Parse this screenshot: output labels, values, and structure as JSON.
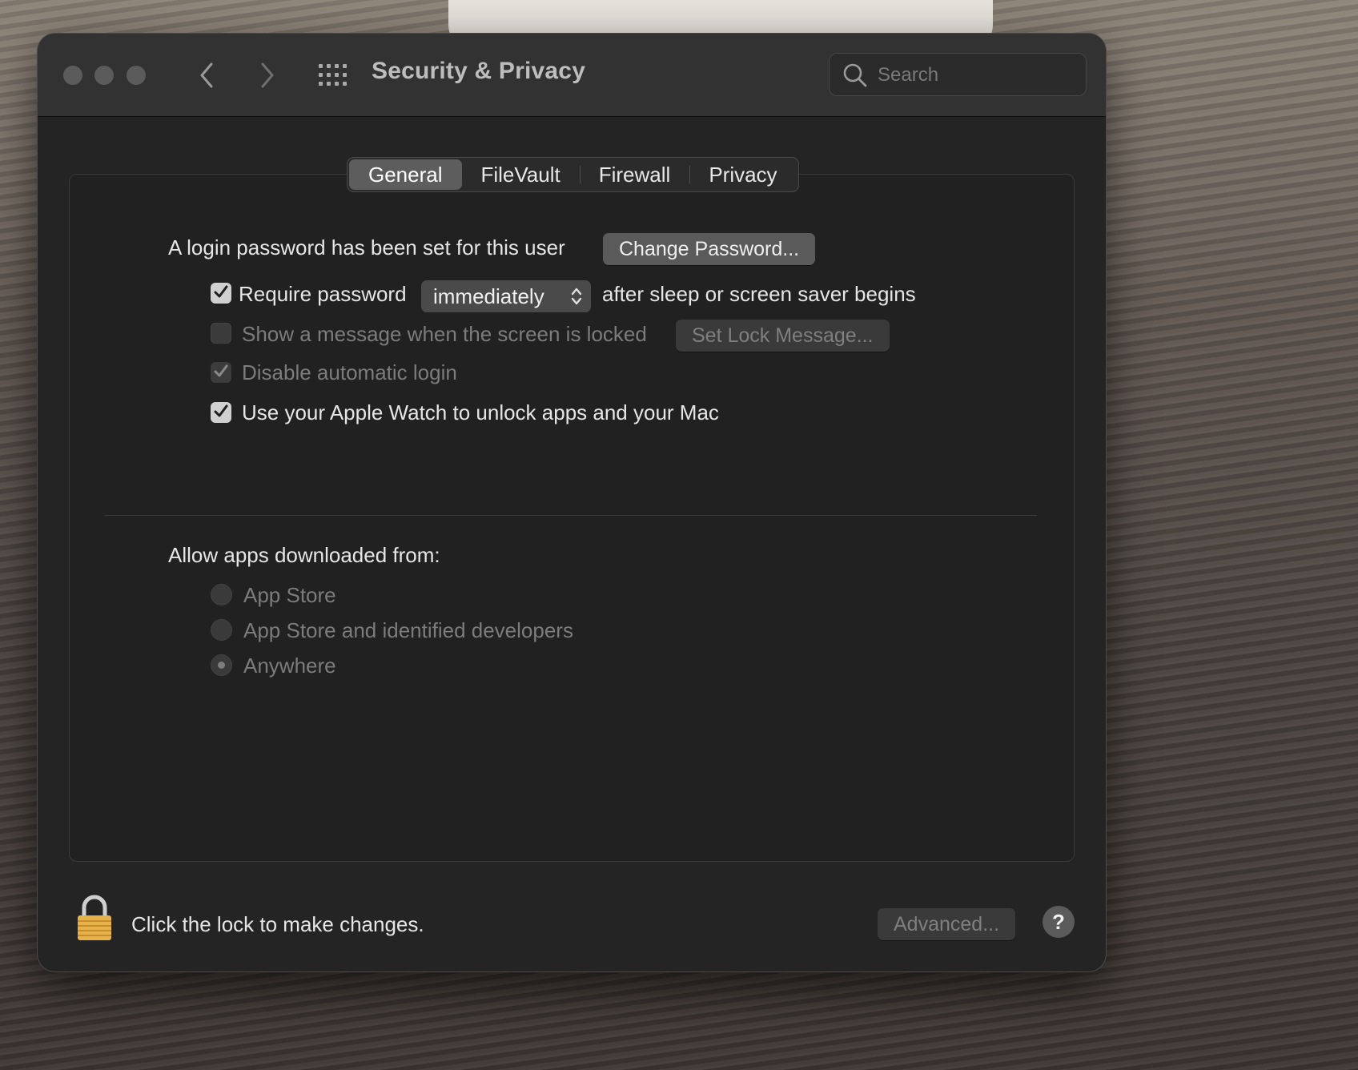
{
  "window": {
    "title": "Security & Privacy"
  },
  "toolbar": {
    "search_placeholder": "Search",
    "icons": [
      "chevron-left-icon",
      "chevron-right-icon",
      "grid-icon",
      "search-icon"
    ]
  },
  "tabs": [
    {
      "label": "General",
      "selected": true
    },
    {
      "label": "FileVault",
      "selected": false
    },
    {
      "label": "Firewall",
      "selected": false
    },
    {
      "label": "Privacy",
      "selected": false
    }
  ],
  "general": {
    "login_password_text": "A login password has been set for this user",
    "change_password_label": "Change Password...",
    "require_password": {
      "label": "Require password",
      "checked": true,
      "select_value": "immediately",
      "suffix": "after sleep or screen saver begins"
    },
    "show_message": {
      "label": "Show a message when the screen is locked",
      "checked": false,
      "enabled": false,
      "button_label": "Set Lock Message..."
    },
    "disable_auto_login": {
      "label": "Disable automatic login",
      "checked": true,
      "enabled": false
    },
    "apple_watch": {
      "label": "Use your Apple Watch to unlock apps and your Mac",
      "checked": true
    }
  },
  "allow_apps": {
    "heading": "Allow apps downloaded from:",
    "options": [
      {
        "label": "App Store",
        "selected": false
      },
      {
        "label": "App Store and identified developers",
        "selected": false
      },
      {
        "label": "Anywhere",
        "selected": true
      }
    ]
  },
  "footer": {
    "lock_text": "Click the lock to make changes.",
    "advanced_label": "Advanced...",
    "help_label": "?"
  },
  "colors": {
    "window_bg": "#242424",
    "titlebar_bg": "#323232",
    "button_bg": "#5a5a5a",
    "lock_gold": "#e8b24a"
  }
}
